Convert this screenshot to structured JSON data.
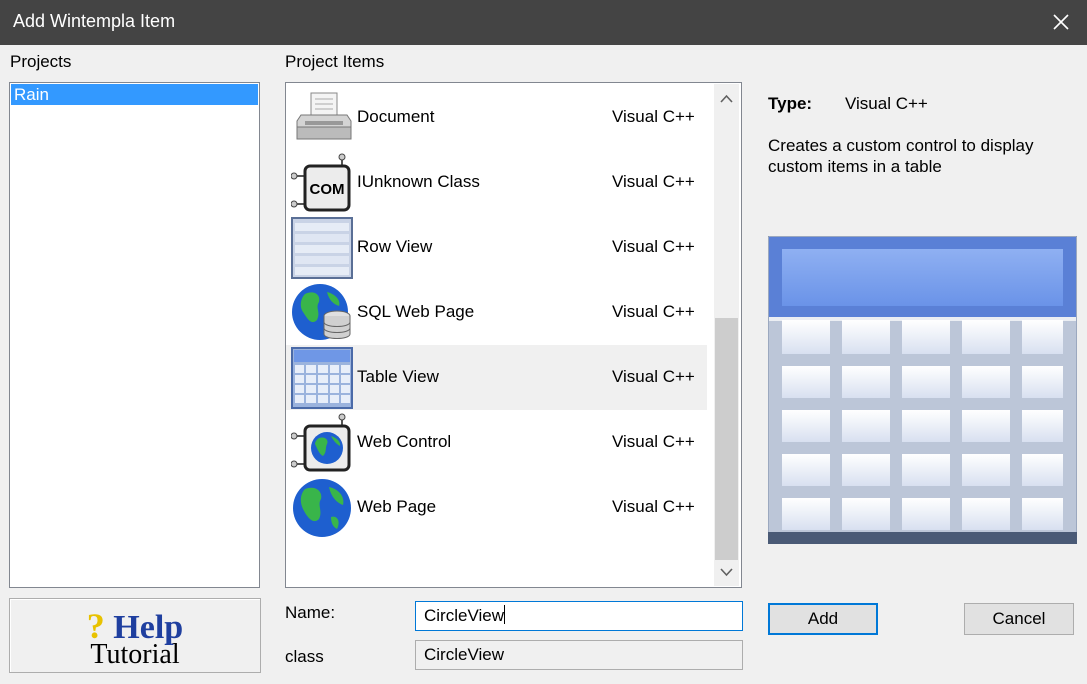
{
  "window": {
    "title": "Add Wintempla Item"
  },
  "projects": {
    "label": "Projects",
    "items": [
      {
        "name": "Rain",
        "selected": true
      }
    ]
  },
  "help": {
    "line1": "Help",
    "line2": "Tutorial"
  },
  "project_items": {
    "label": "Project Items",
    "items": [
      {
        "name": "Document",
        "language": "Visual C++",
        "icon": "printer-icon"
      },
      {
        "name": "IUnknown Class",
        "language": "Visual C++",
        "icon": "com-chip-icon"
      },
      {
        "name": "Row View",
        "language": "Visual C++",
        "icon": "row-view-icon"
      },
      {
        "name": "SQL Web Page",
        "language": "Visual C++",
        "icon": "globe-database-icon"
      },
      {
        "name": "Table View",
        "language": "Visual C++",
        "icon": "table-view-icon",
        "selected": true
      },
      {
        "name": "Web Control",
        "language": "Visual C++",
        "icon": "globe-chip-icon"
      },
      {
        "name": "Web Page",
        "language": "Visual C++",
        "icon": "globe-icon"
      }
    ]
  },
  "details": {
    "type_label": "Type:",
    "type_value": "Visual C++",
    "description": "Creates a custom control to display custom items in a table"
  },
  "form": {
    "name_label": "Name:",
    "name_value": "CircleView",
    "class_label": "class",
    "class_value": "CircleView"
  },
  "buttons": {
    "add": "Add",
    "cancel": "Cancel"
  },
  "colors": {
    "titlebar": "#444444",
    "selection": "#3399ff",
    "focus_border": "#0078d7",
    "help_text": "#1f3f9f"
  }
}
